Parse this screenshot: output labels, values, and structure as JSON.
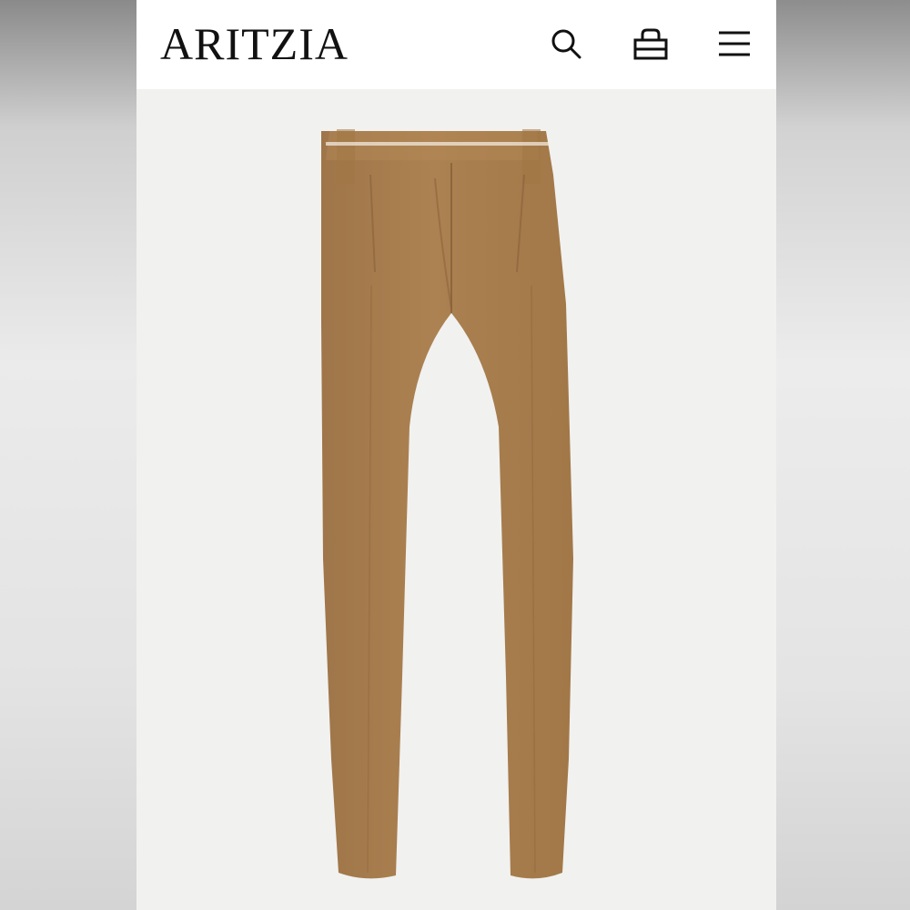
{
  "header": {
    "brand": "ARITZIA",
    "icons": {
      "search": "search-icon",
      "bag": "shopping-bag-icon",
      "menu": "menu-icon"
    }
  },
  "product": {
    "image": "product-image",
    "color": "#a97f4e"
  },
  "colors": {
    "header_bg": "#ffffff",
    "page_bg": "#f1f1f0",
    "text": "#111111"
  }
}
